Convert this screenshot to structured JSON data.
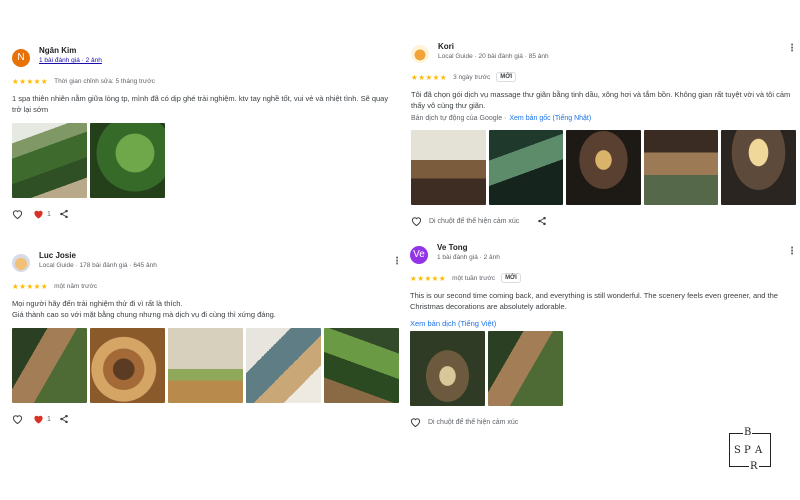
{
  "reviews": [
    {
      "name": "Ngân Kim",
      "avatar_letter": "N",
      "avatar_color": "#e8710a",
      "sub": "1 bài đánh giá · 2 ảnh",
      "rating": "★★★★★",
      "time": "Thời gian chỉnh sửa: 5 tháng trước",
      "text": "1 spa thiên nhiên nằm giữa lòng tp, mình đã có dịp ghé trải nghiệm. ktv tay nghề tốt, vui vẻ và nhiệt tình. Sẽ quay trở lại sớm",
      "like_count": "1"
    },
    {
      "name": "Kori",
      "sub": "Local Guide · 20 bài đánh giá · 85 ảnh",
      "rating": "★★★★★",
      "time": "3 ngày trước",
      "badge": "MỚI",
      "text": "Tôi đã chọn gói dịch vụ massage thư giãn bằng tinh dầu, xông hơi và tắm bồn. Không gian rất tuyệt vời và tôi cảm thấy vô cùng thư giãn.",
      "translate_note": "Bản dịch tự động của Google ·",
      "translate_link": "Xem bản gốc (Tiếng Nhật)",
      "hover_text": "Di chuột để thể hiện cảm xúc"
    },
    {
      "name": "Luc Josie",
      "sub": "Local Guide · 178 bài đánh giá · 645 ảnh",
      "rating": "★★★★★",
      "time": "một năm trước",
      "text_line1": "Mọi người hãy đến trải nghiệm thử đi vì rất là thích.",
      "text_line2": "Giá thành cao so với mặt bằng chung nhưng mà dịch vụ đi cùng thì xứng đáng.",
      "like_count": "1"
    },
    {
      "name": "Ve Tong",
      "avatar_letter": "Ve",
      "avatar_color": "#9334e6",
      "sub": "1 bài đánh giá · 2 ảnh",
      "rating": "★★★★★",
      "time": "một tuần trước",
      "badge": "MỚI",
      "text": "This is our second time coming back, and everything is still wonderful. The scenery feels even greener, and the Christmas decorations are absolutely adorable.",
      "translate_link": "Xem bản dịch (Tiếng Việt)",
      "hover_text": "Di chuột để thể hiện cảm xúc"
    }
  ],
  "more_icon": "⋮",
  "icons": [
    "heart-outline-icon",
    "heart-filled-icon",
    "share-icon",
    "more-vert-icon"
  ],
  "logo": {
    "letters": [
      "S",
      "P",
      "A",
      "R",
      "B"
    ]
  },
  "colors": {
    "star": "#fbbc04",
    "link": "#1a73e8",
    "heart": "#d93025"
  }
}
